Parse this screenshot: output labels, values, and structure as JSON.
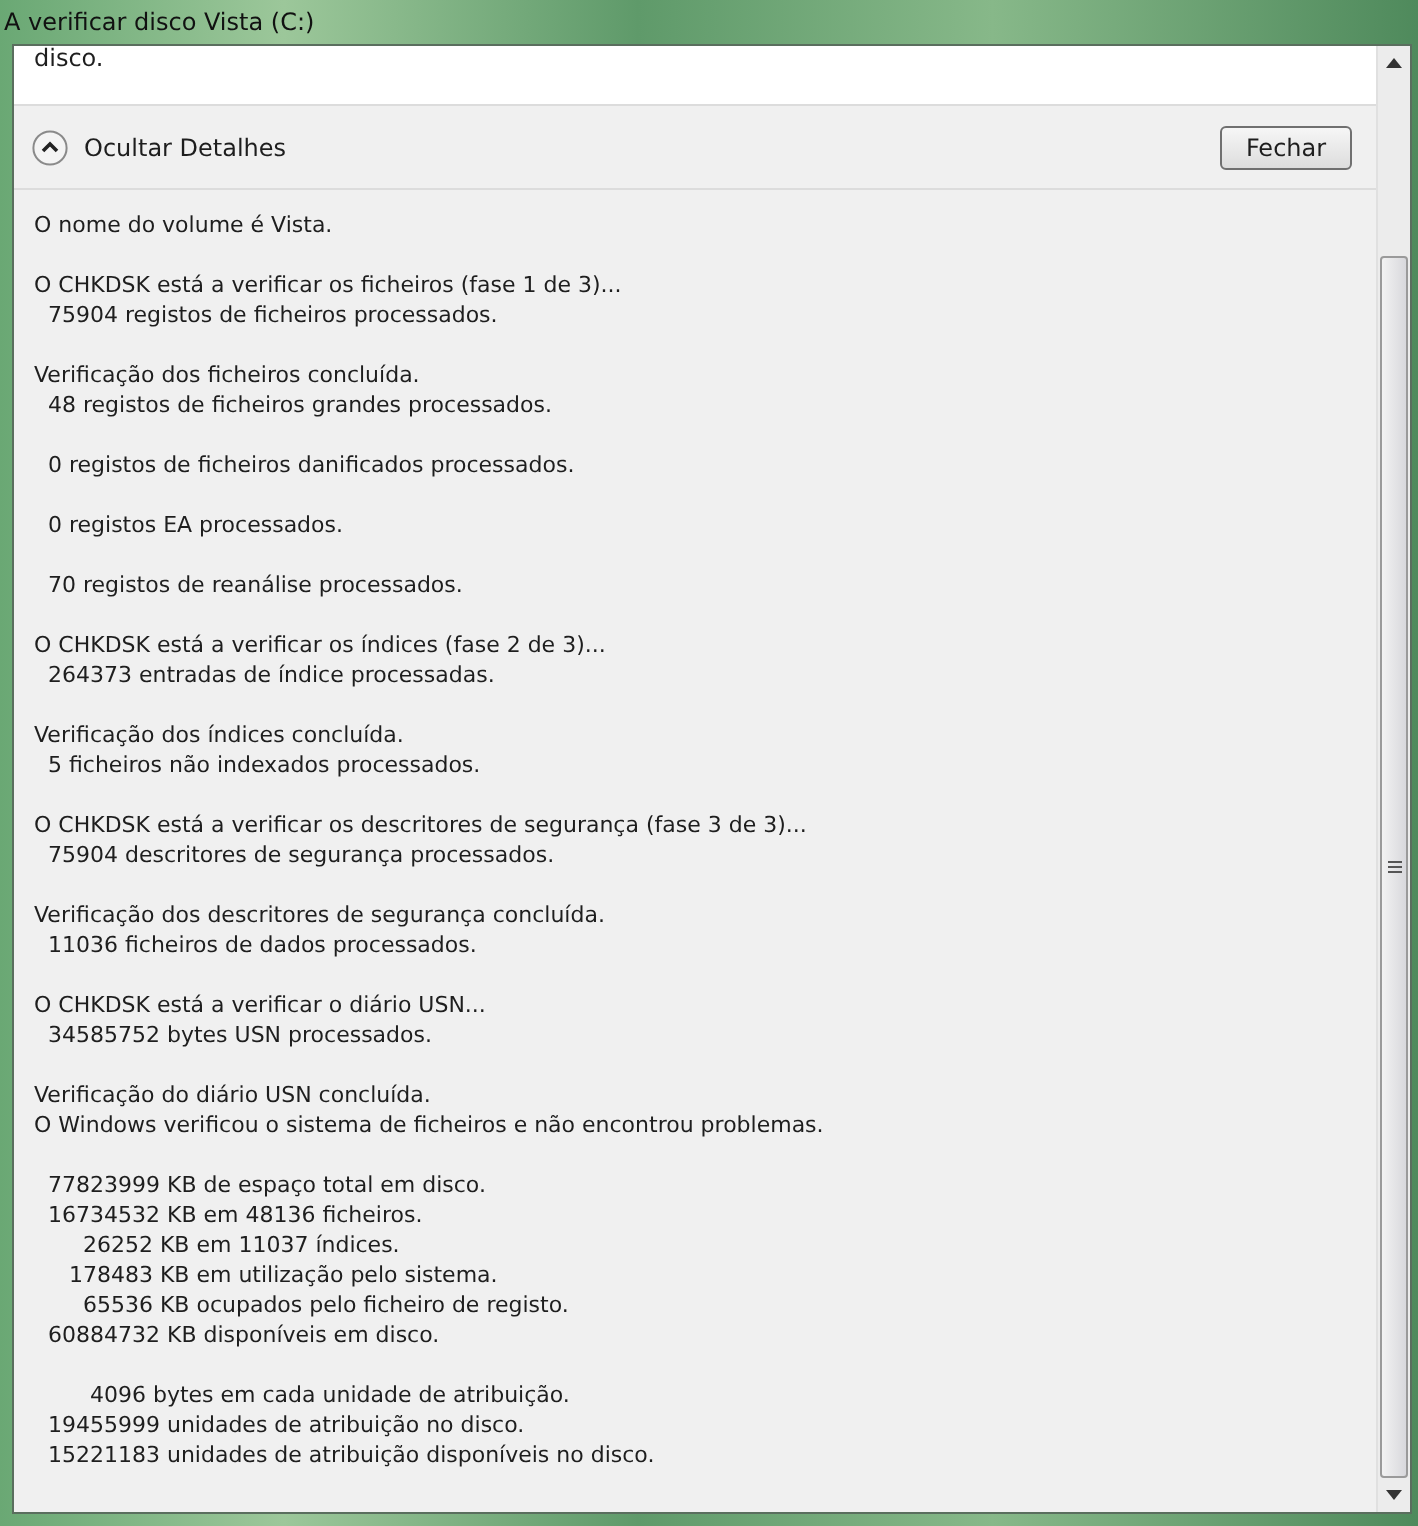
{
  "window": {
    "title": "A verificar disco Vista (C:)"
  },
  "message": "disco.",
  "details_toggle": {
    "label": "Ocultar Detalhes",
    "expanded": true
  },
  "close_button": "Fechar",
  "details": [
    [
      "O nome do volume é Vista."
    ],
    [
      "O CHKDSK está a verificar os ficheiros (fase 1 de 3)...",
      "  75904 registos de ficheiros processados."
    ],
    [
      "Verificação dos ficheiros concluída.",
      "  48 registos de ficheiros grandes processados."
    ],
    [
      "  0 registos de ficheiros danificados processados."
    ],
    [
      "  0 registos EA processados."
    ],
    [
      "  70 registos de reanálise processados."
    ],
    [
      "O CHKDSK está a verificar os índices (fase 2 de 3)...",
      "  264373 entradas de índice processadas."
    ],
    [
      "Verificação dos índices concluída.",
      "  5 ficheiros não indexados processados."
    ],
    [
      "O CHKDSK está a verificar os descritores de segurança (fase 3 de 3)...",
      "  75904 descritores de segurança processados."
    ],
    [
      "Verificação dos descritores de segurança concluída.",
      "  11036 ficheiros de dados processados."
    ],
    [
      "O CHKDSK está a verificar o diário USN...",
      "  34585752 bytes USN processados."
    ],
    [
      "Verificação do diário USN concluída.",
      "O Windows verificou o sistema de ficheiros e não encontrou problemas."
    ],
    [
      "  77823999 KB de espaço total em disco.",
      "  16734532 KB em 48136 ficheiros.",
      "       26252 KB em 11037 índices.",
      "     178483 KB em utilização pelo sistema.",
      "       65536 KB ocupados pelo ficheiro de registo.",
      "  60884732 KB disponíveis em disco."
    ],
    [
      "        4096 bytes em cada unidade de atribuição.",
      "  19455999 unidades de atribuição no disco.",
      "  15221183 unidades de atribuição disponíveis no disco."
    ]
  ]
}
